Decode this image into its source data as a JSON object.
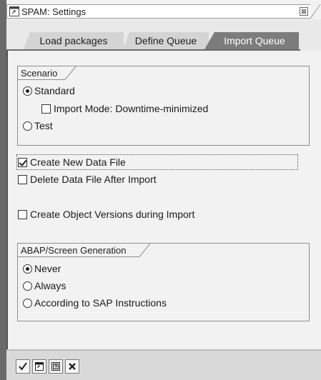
{
  "window": {
    "title": "SPAM: Settings",
    "close_glyph": "⊠"
  },
  "tabs": [
    {
      "label": "Load packages",
      "active": false
    },
    {
      "label": "Define Queue",
      "active": false
    },
    {
      "label": "Import Queue",
      "active": true
    }
  ],
  "scenario": {
    "title": "Scenario",
    "options": [
      {
        "label": "Standard",
        "selected": true
      },
      {
        "label": "Test",
        "selected": false
      }
    ],
    "import_mode": {
      "label": "Import Mode: Downtime-minimized",
      "checked": false
    }
  },
  "options": [
    {
      "label": "Create New Data File",
      "checked": true
    },
    {
      "label": "Delete Data File After Import",
      "checked": false
    },
    {
      "label": "Create Object Versions during Import",
      "checked": false
    }
  ],
  "generation": {
    "title": "ABAP/Screen Generation",
    "options": [
      {
        "label": "Never",
        "selected": true
      },
      {
        "label": "Always",
        "selected": false
      },
      {
        "label": "According to SAP Instructions",
        "selected": false
      }
    ]
  },
  "toolbar": {
    "buttons": [
      {
        "name": "confirm-icon"
      },
      {
        "name": "save-settings-icon"
      },
      {
        "name": "help-icon"
      },
      {
        "name": "cancel-icon"
      }
    ]
  }
}
